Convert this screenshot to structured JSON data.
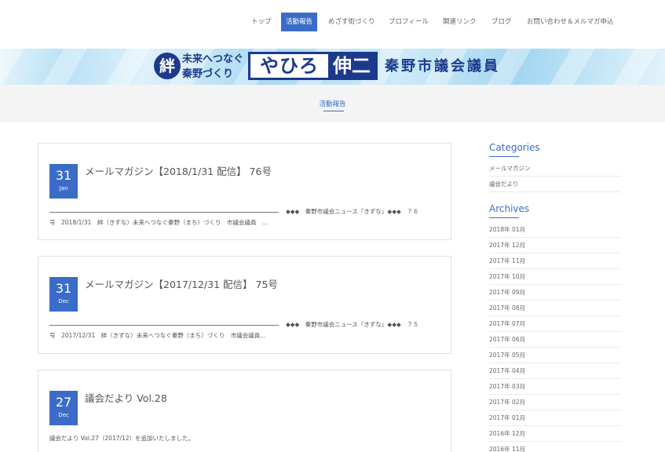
{
  "nav": {
    "items": [
      {
        "label": "トップ",
        "active": false
      },
      {
        "label": "活動報告",
        "active": true
      },
      {
        "label": "めざす街づくり",
        "active": false
      },
      {
        "label": "プロフィール",
        "active": false
      },
      {
        "label": "関連リンク",
        "active": false
      },
      {
        "label": "ブログ",
        "active": false
      },
      {
        "label": "お問い合わせ＆メルマガ申込",
        "active": false
      }
    ]
  },
  "banner": {
    "kizuna": "絆",
    "slogan_line1": "未来へつなぐ",
    "slogan_line2": "秦野づくり",
    "name_left": "やひろ",
    "name_right": "伸二",
    "title": "秦野市議会議員"
  },
  "page": {
    "title": "活動報告"
  },
  "posts": [
    {
      "day": "31",
      "month": "Jan",
      "title": "メールマガジン【2018/1/31 配信】 76号",
      "excerpt_right": "◆◆◆　秦野市議会ニュース『きずな』◆◆◆　７６",
      "excerpt_line": "号　2018/1/31　絆（きずな）未来へつなぐ秦野（まち）づくり　市議会議員　..."
    },
    {
      "day": "31",
      "month": "Dec",
      "title": "メールマガジン【2017/12/31 配信】 75号",
      "excerpt_right": "◆◆◆　秦野市議会ニュース『きずな』◆◆◆　７５",
      "excerpt_line": "号　2017/12/31　絆（きずな）未来へつなぐ秦野（まち）づくり　市議会議員..."
    },
    {
      "day": "27",
      "month": "Dec",
      "title": "議会だより Vol.28",
      "excerpt_line": "議会だより Vol.27（2017/12）を追加いたしました。"
    }
  ],
  "sidebar": {
    "categories_heading": "Categories",
    "categories": [
      "メールマガジン",
      "議会だより"
    ],
    "archives_heading": "Archives",
    "archives": [
      "2018年 01月",
      "2017年 12月",
      "2017年 11月",
      "2017年 10月",
      "2017年 09月",
      "2017年 08月",
      "2017年 07月",
      "2017年 06月",
      "2017年 05月",
      "2017年 04月",
      "2017年 03月",
      "2017年 02月",
      "2017年 01月",
      "2016年 12月",
      "2016年 11月"
    ]
  }
}
